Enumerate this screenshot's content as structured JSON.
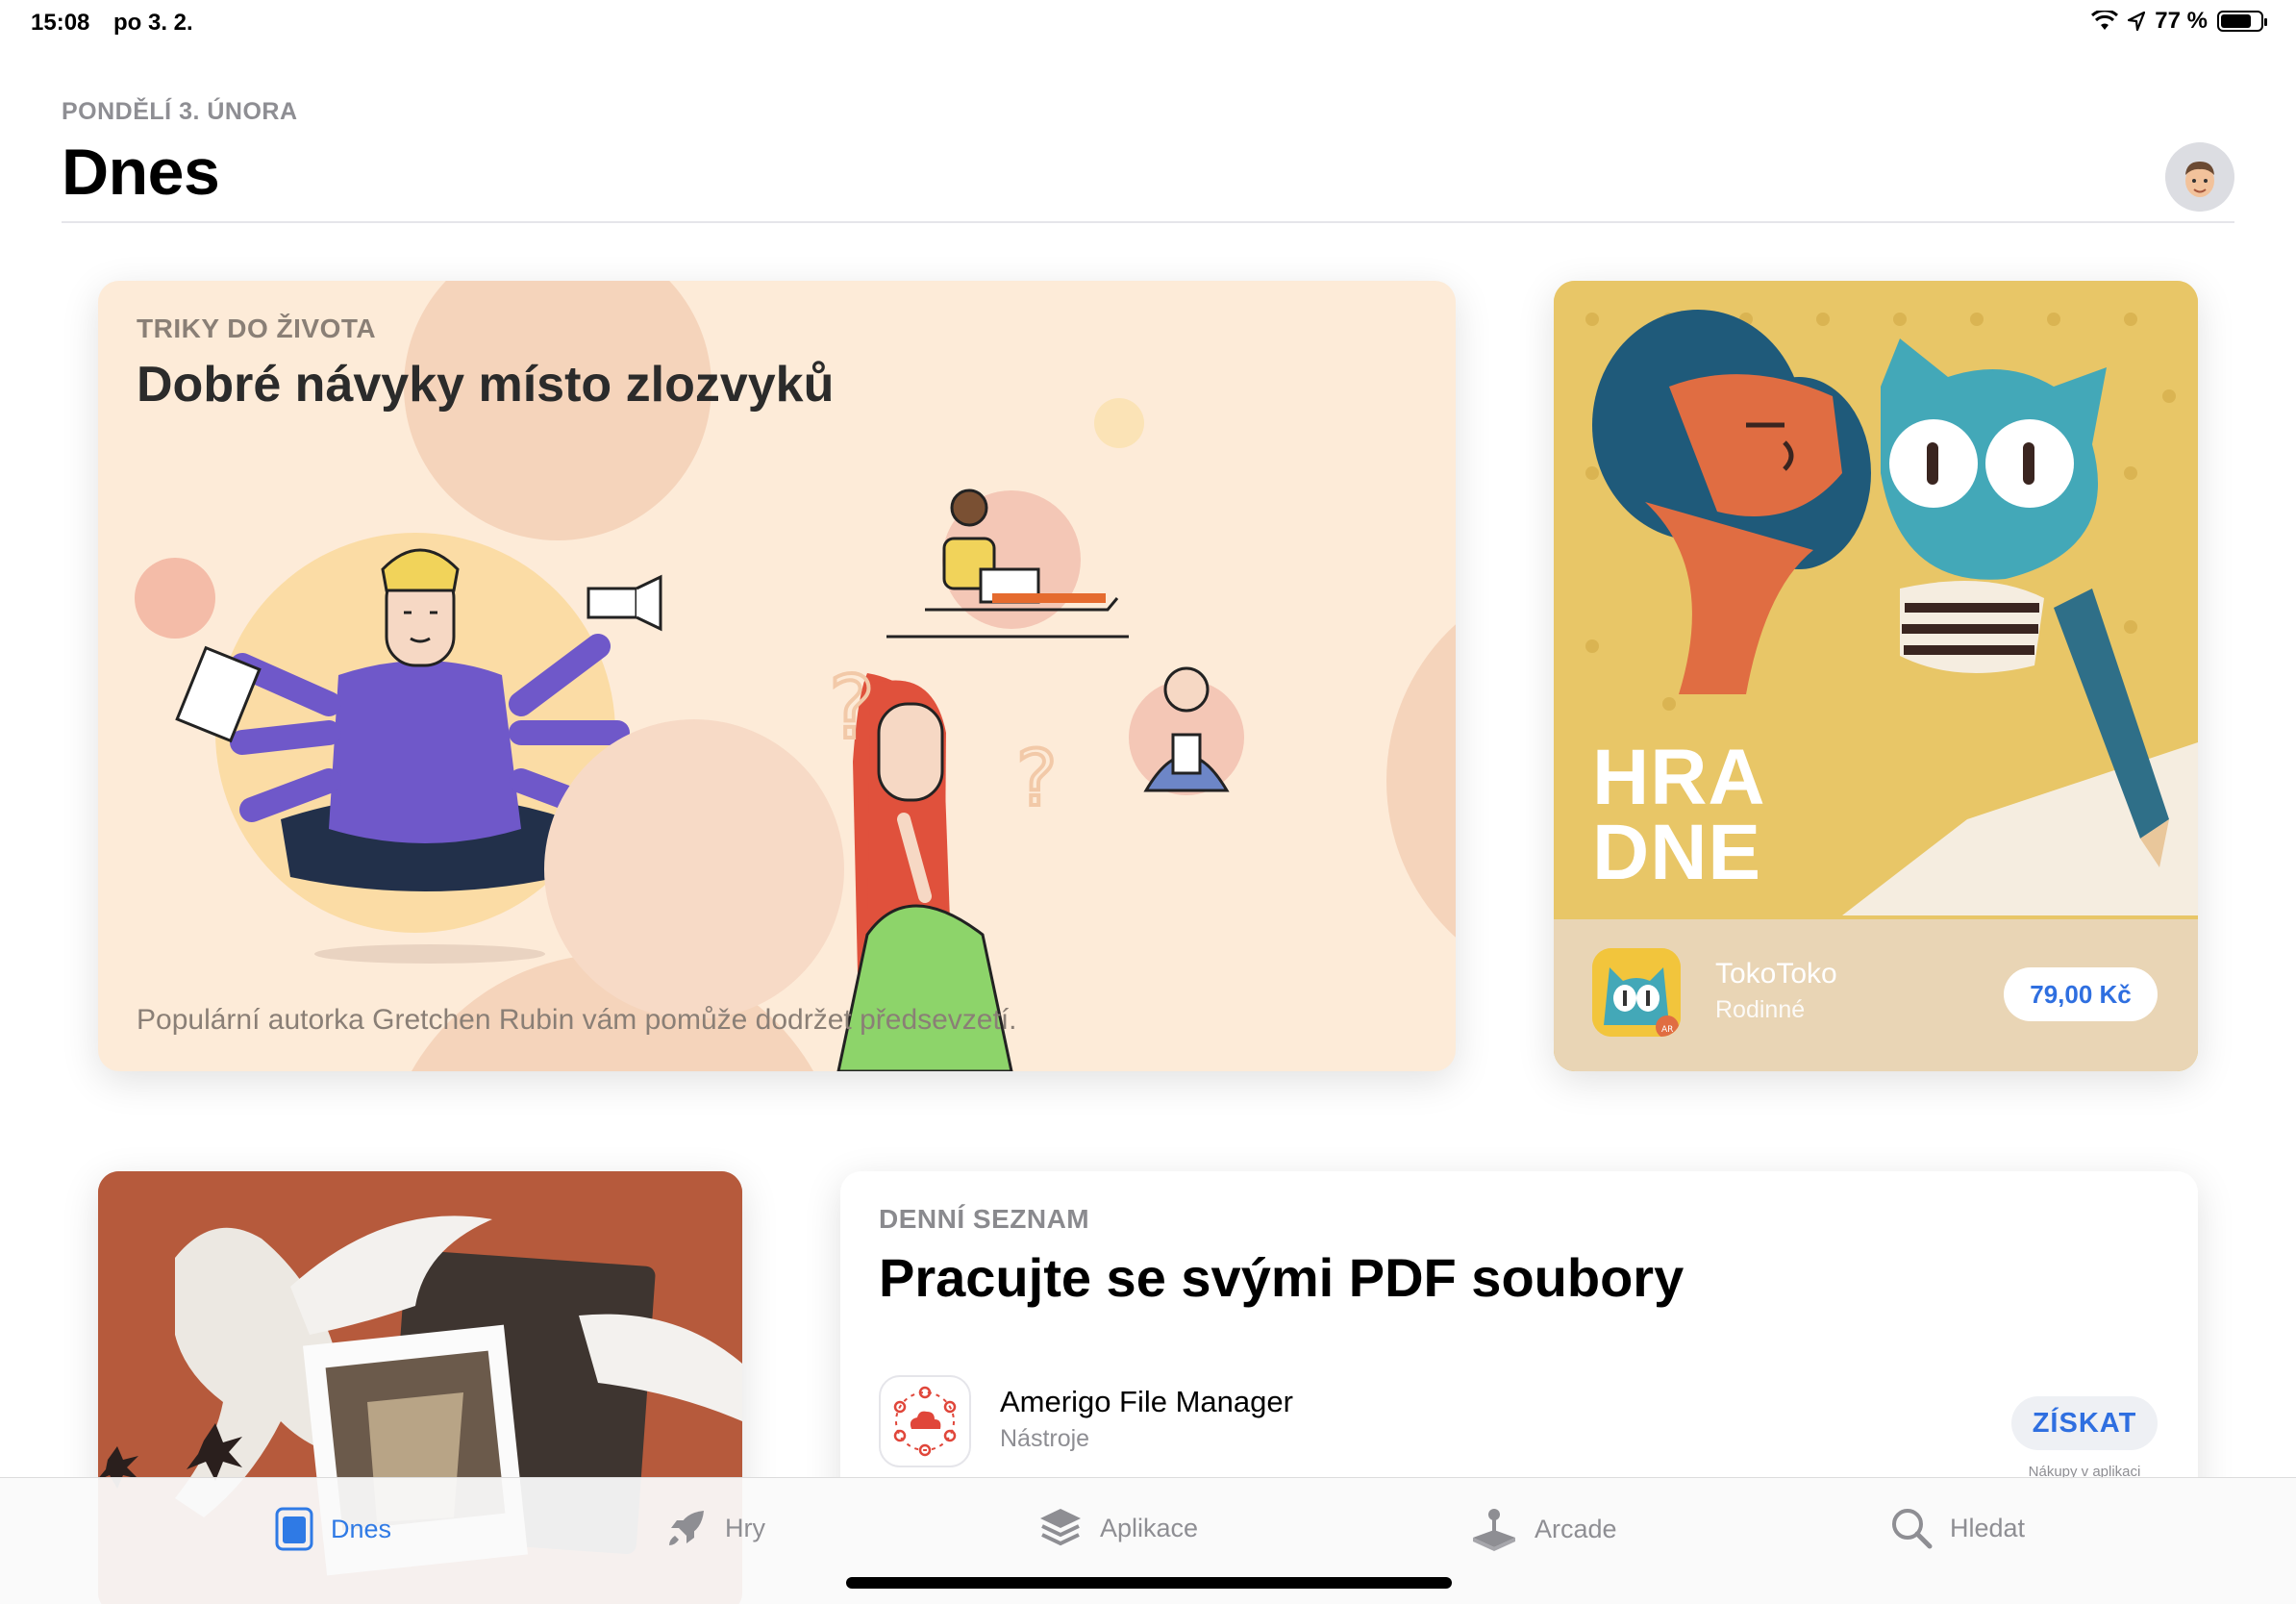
{
  "status_bar": {
    "time": "15:08",
    "date": "po 3. 2.",
    "battery": "77 %",
    "battery_level": 0.77
  },
  "header": {
    "date_label": "PONDĚLÍ 3. ÚNORA",
    "title": "Dnes"
  },
  "cards": {
    "habits": {
      "kicker": "TRIKY DO ŽIVOTA",
      "title": "Dobré návyky místo zlozvyků",
      "subtitle": "Populární autorka Gretchen Rubin vám pomůže dodržet předsevzetí."
    },
    "game_of_day": {
      "kicker": "HRA DNE",
      "app_name": "TokoToko",
      "app_category": "Rodinné",
      "price": "79,00 Kč",
      "icon_badge": "AR"
    },
    "daily_list": {
      "kicker": "DENNÍ SEZNAM",
      "title": "Pracujte se svými PDF soubory",
      "app_name": "Amerigo File Manager",
      "app_category": "Nástroje",
      "button": "ZÍSKAT",
      "iap_note": "Nákupy v aplikaci"
    }
  },
  "tabs": [
    {
      "label": "Dnes",
      "icon": "today-icon",
      "active": true
    },
    {
      "label": "Hry",
      "icon": "rocket-icon",
      "active": false
    },
    {
      "label": "Aplikace",
      "icon": "layers-icon",
      "active": false
    },
    {
      "label": "Arcade",
      "icon": "joystick-icon",
      "active": false
    },
    {
      "label": "Hledat",
      "icon": "search-icon",
      "active": false
    }
  ],
  "colors": {
    "accent": "#2f7ae5",
    "habits_bg": "#fdebd8",
    "game_bg": "#e8c667",
    "art_bg": "#b65a3c"
  }
}
